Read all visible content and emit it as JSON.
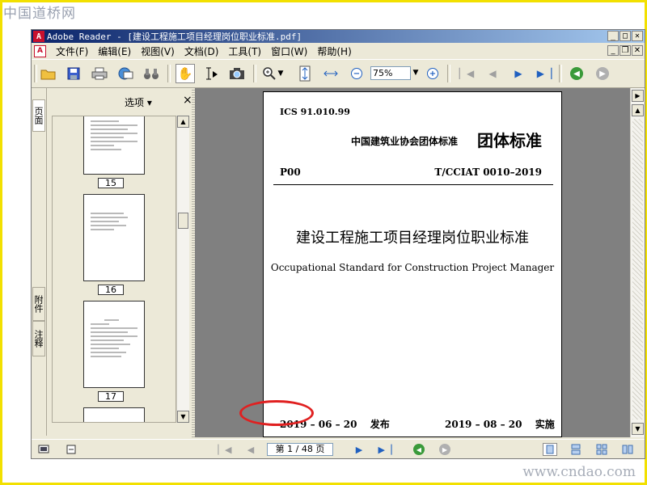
{
  "watermarks": {
    "top": "中国道桥网",
    "bottom": "www.cndao.com"
  },
  "window": {
    "title": "Adobe Reader - [建设工程施工项目经理岗位职业标准.pdf]"
  },
  "menu": {
    "items": [
      "文件(F)",
      "编辑(E)",
      "视图(V)",
      "文档(D)",
      "工具(T)",
      "窗口(W)",
      "帮助(H)"
    ]
  },
  "toolbar": {
    "zoom_value": "75%",
    "icons": [
      "open-folder-icon",
      "save-icon",
      "print-icon",
      "email-icon",
      "search-binoculars-icon",
      "hand-tool-icon",
      "select-text-icon",
      "snapshot-icon",
      "zoom-in-icon",
      "fit-height-icon",
      "fit-width-icon",
      "zoom-out-icon",
      "zoom-in-plus-icon",
      "first-page-icon",
      "prev-page-icon",
      "next-page-icon",
      "last-page-icon",
      "back-icon",
      "forward-icon"
    ]
  },
  "nav_tabs": {
    "pages": "页面",
    "attachments": "附件",
    "comments": "注释"
  },
  "thumbnails": {
    "options_label": "选项 ▾",
    "close_label": "×",
    "pages": [
      "15",
      "16",
      "17"
    ]
  },
  "document": {
    "ics": "ICS 91.010.99",
    "association": "中国建筑业协会团体标准",
    "standard_type": "团体标准",
    "category_code": "P00",
    "standard_number": "T/CCIAT 0010–2019",
    "title_cn": "建设工程施工项目经理岗位职业标准",
    "title_en": "Occupational Standard for Construction Project Manager",
    "issue_date": "2019 – 06 – 20",
    "issue_label": "发布",
    "impl_date": "2019 – 08 – 20",
    "impl_label": "实施"
  },
  "statusbar": {
    "page_indicator": "第 1 / 48 页"
  },
  "colors": {
    "frame": "#f2e000",
    "highlight": "#e02020",
    "titlebar": "#0a246a"
  }
}
